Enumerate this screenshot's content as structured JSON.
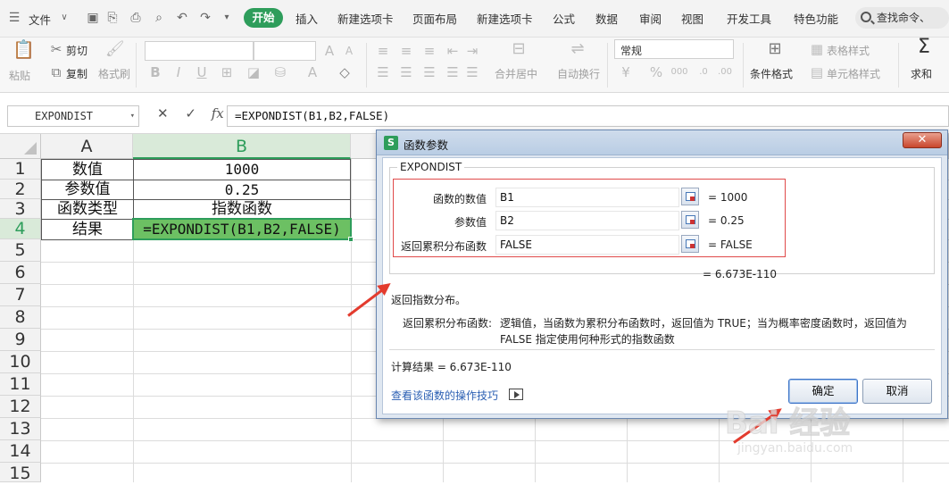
{
  "menubar": {
    "file_label": "文件",
    "tabs": [
      "开始",
      "插入",
      "新建选项卡",
      "页面布局",
      "新建选项卡",
      "公式",
      "数据",
      "审阅",
      "视图",
      "开发工具",
      "特色功能"
    ],
    "search_placeholder": "查找命令、"
  },
  "ribbon": {
    "paste": "粘贴",
    "cut": "剪切",
    "copy": "复制",
    "format_painter": "格式刷",
    "merge_center": "合并居中",
    "wrap_text": "自动换行",
    "number_format": "常规",
    "conditional_format": "条件格式",
    "table_style": "表格样式",
    "cell_style": "单元格样式",
    "sum": "求和"
  },
  "formula_bar": {
    "name_box": "EXPONDIST",
    "formula": "=EXPONDIST(B1,B2,FALSE)"
  },
  "sheet": {
    "columns": [
      "A",
      "B"
    ],
    "rows": [
      "1",
      "2",
      "3",
      "4",
      "5",
      "6",
      "7",
      "8",
      "9",
      "10",
      "11",
      "12",
      "13",
      "14",
      "15"
    ],
    "cells": {
      "a1": "数值",
      "b1": "1000",
      "a2": "参数值",
      "b2": "0.25",
      "a3": "函数类型",
      "b3": "指数函数",
      "a4": "结果",
      "b4": "=EXPONDIST(B1,B2,FALSE)"
    }
  },
  "dialog": {
    "title": "函数参数",
    "close": "✕",
    "function_name": "EXPONDIST",
    "args": [
      {
        "label": "函数的数值",
        "value": "B1",
        "result": "= 1000"
      },
      {
        "label": "参数值",
        "value": "B2",
        "result": "= 0.25"
      },
      {
        "label": "返回累积分布函数",
        "value": "FALSE",
        "result": "= FALSE"
      }
    ],
    "formula_result": "= 6.673E-110",
    "description": "返回指数分布。",
    "arg_desc_label": "返回累积分布函数:",
    "arg_desc_line1": "逻辑值，当函数为累积分布函数时，返回值为 TRUE；当为概率密度函数时，返回值为",
    "arg_desc_line2": "FALSE 指定使用何种形式的指数函数",
    "calc_result": "计算结果 = 6.673E-110",
    "help_link": "查看该函数的操作技巧",
    "ok": "确定",
    "cancel": "取消"
  },
  "watermark": {
    "line1": "Bai 经验",
    "line2": "jingyan.baidu.com"
  },
  "colors": {
    "accent_green": "#2e9d5b",
    "arrow_red": "#e33b2e",
    "highlight_box": "#e04a4a"
  }
}
